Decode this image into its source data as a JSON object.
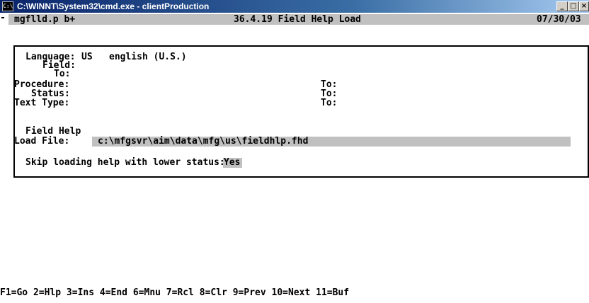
{
  "window": {
    "title": "C:\\WINNT\\System32\\cmd.exe - clientProduction",
    "icon": "cmd-icon",
    "icon_text": "C:\\",
    "minimize_glyph": "_",
    "maximize_glyph": "□",
    "close_glyph": "×"
  },
  "header": {
    "program": "mgflld.p b+",
    "menu_title": "36.4.19 Field Help Load",
    "date": "07/30/03"
  },
  "form": {
    "language_label": "Language:",
    "language_code": "US",
    "language_desc": "english (U.S.)",
    "field_label": "Field:",
    "field_to_label": "To:",
    "procedure_label": "Procedure:",
    "procedure_to_label": "To:",
    "status_label": "Status:",
    "status_to_label": "To:",
    "text_type_label": "Text Type:",
    "text_type_to_label": "To:",
    "field_help_label": "Field Help",
    "load_file_label": "Load File:",
    "load_file_value": "c:\\mfgsvr\\aim\\data\\mfg\\us\\fieldhlp.fhd",
    "skip_label": "Skip loading help with lower status:",
    "skip_value": "Yes"
  },
  "function_keys": "F1=Go 2=Hlp 3=Ins 4=End 6=Mnu 7=Rcl 8=Clr 9=Prev 10=Next 11=Buf",
  "colors": {
    "titlebar_start": "#0a246a",
    "titlebar_end": "#a6caf0",
    "highlight": "#c0c0c0",
    "text": "#000000",
    "background": "#ffffff"
  }
}
